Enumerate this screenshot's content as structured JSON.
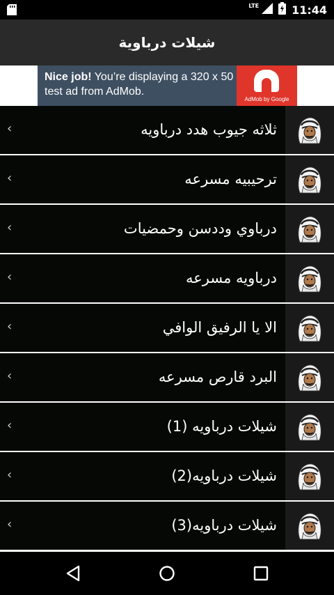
{
  "status_bar": {
    "network": "LTE",
    "time": "11:44"
  },
  "app_bar": {
    "title": "شيلات درباوية"
  },
  "ad": {
    "headline": "Nice job!",
    "body": " You’re displaying a 320 x 50 test ad from AdMob.",
    "logo_text": "AdMob by Google",
    "colors": {
      "panel": "#3e4f61",
      "logo": "#e0352b"
    }
  },
  "items": [
    {
      "label": "ثلاثه جيوب هدد درباويه"
    },
    {
      "label": "ترحيبيه مسرعه"
    },
    {
      "label": "درباوي وددسن وحمضيات"
    },
    {
      "label": "درباويه مسرعه"
    },
    {
      "label": "الا يا الرفيق الوافي"
    },
    {
      "label": "البرد قارص مسرعه"
    },
    {
      "label": "شيلات درباويه (1)"
    },
    {
      "label": "شيلات درباويه(2)"
    },
    {
      "label": "شيلات درباويه(3)"
    }
  ],
  "icons": {
    "chevron": "chevron-left-icon",
    "avatar": "man-with-shemagh-icon",
    "nav_back": "back-triangle-icon",
    "nav_home": "home-circle-icon",
    "nav_recents": "recents-square-icon"
  }
}
